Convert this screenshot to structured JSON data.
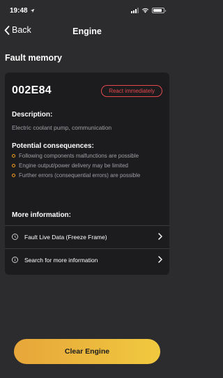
{
  "status_bar": {
    "time": "19:48"
  },
  "nav": {
    "back_label": "Back",
    "title": "Engine"
  },
  "section_title": "Fault memory",
  "fault": {
    "code": "002E84",
    "badge": "React immediately",
    "description_label": "Description:",
    "description": "Electric coolant pump, communication",
    "consequences_label": "Potential consequences:",
    "consequences": [
      "Following components malfunctions are possible",
      "Engine output/power delivery may be limited",
      "Further errors (consequential errors) are possible"
    ],
    "more_info_label": "More information:",
    "info_rows": [
      {
        "label": "Fault Live Data (Freeze Frame)",
        "icon": "clock-icon"
      },
      {
        "label": "Search for more information",
        "icon": "info-icon"
      }
    ]
  },
  "action_button": "Clear Engine",
  "colors": {
    "background": "#2c2c2e",
    "card": "#1c1c1e",
    "danger": "#e5484d",
    "accent": "#f0a020",
    "button_gradient_start": "#e7a63a",
    "button_gradient_end": "#f0c93f"
  }
}
